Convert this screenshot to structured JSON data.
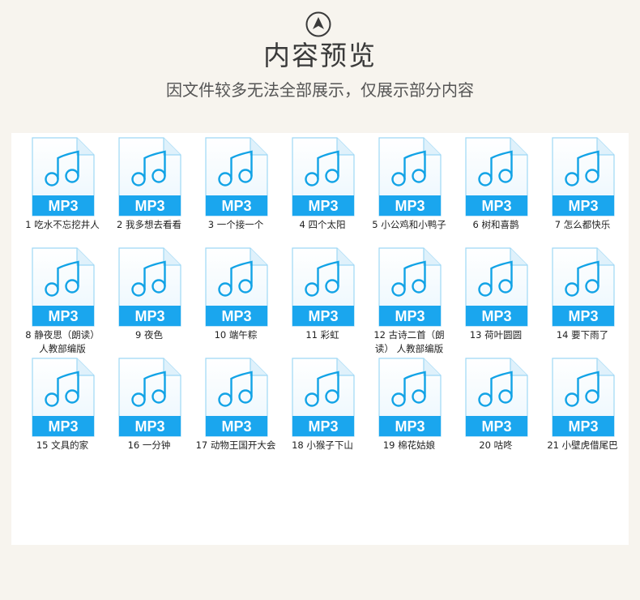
{
  "header": {
    "icon": "up-arrow-circle-icon",
    "title": "内容预览",
    "subtitle": "因文件较多无法全部展示，仅展示部分内容"
  },
  "colors": {
    "background": "#f7f4ee",
    "panel": "#ffffff",
    "icon_blue": "#12a3e6",
    "icon_band": "#1aa6ee"
  },
  "file_type_label": "MP3",
  "files": [
    {
      "label": "1 吃水不忘挖井人"
    },
    {
      "label": "2 我多想去看看"
    },
    {
      "label": "3 一个接一个"
    },
    {
      "label": "4 四个太阳"
    },
    {
      "label": "5 小公鸡和小鸭子"
    },
    {
      "label": "6 树和喜鹊"
    },
    {
      "label": "7 怎么都快乐"
    },
    {
      "label": "8 静夜思（朗读） 人教部编版"
    },
    {
      "label": "9 夜色"
    },
    {
      "label": "10 端午粽"
    },
    {
      "label": "11 彩虹"
    },
    {
      "label": "12 古诗二首（朗读） 人教部编版"
    },
    {
      "label": "13 荷叶圆圆"
    },
    {
      "label": "14 要下雨了"
    },
    {
      "label": "15 文具的家"
    },
    {
      "label": "16 一分钟"
    },
    {
      "label": "17 动物王国开大会"
    },
    {
      "label": "18 小猴子下山"
    },
    {
      "label": "19 棉花姑娘"
    },
    {
      "label": "20 咕咚"
    },
    {
      "label": "21 小壁虎借尾巴"
    }
  ]
}
